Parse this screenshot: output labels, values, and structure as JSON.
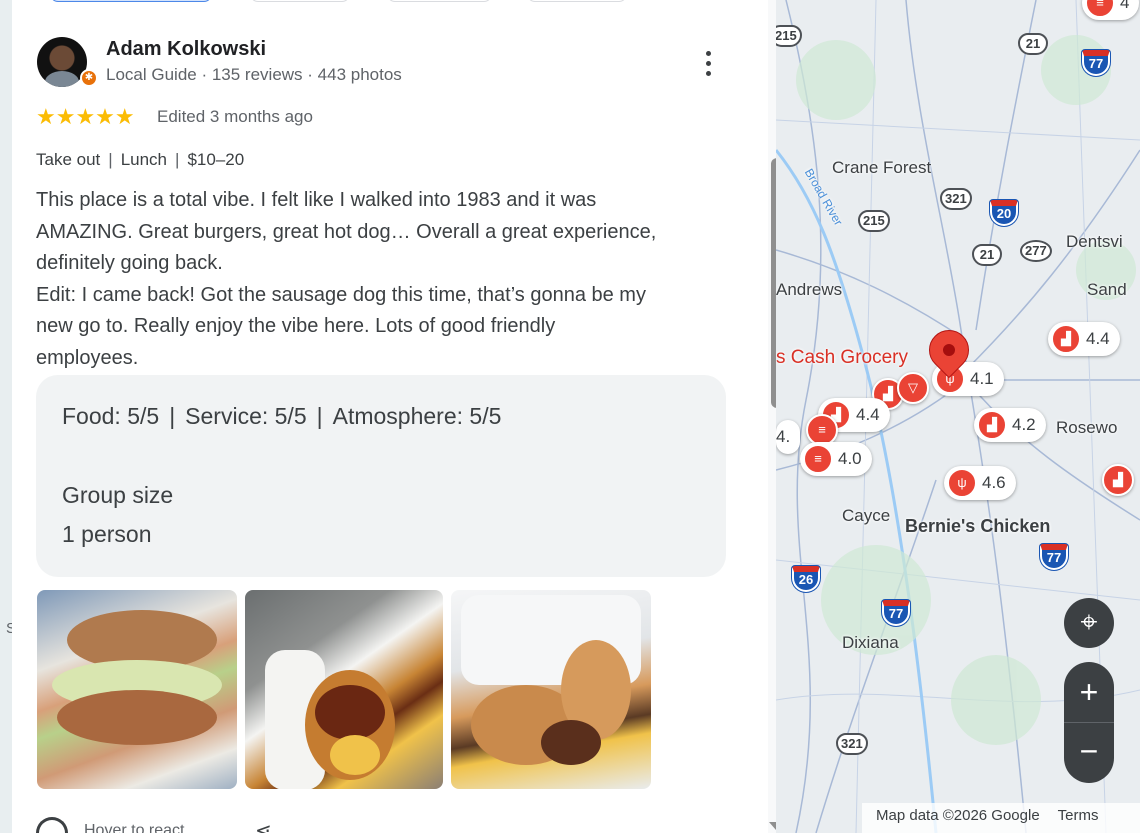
{
  "left_strip": {
    "edge_label": "S"
  },
  "review": {
    "reviewer_name": "Adam Kolkowski",
    "reviewer_meta": "Local Guide · 135 reviews · 443 photos",
    "stars": "★★★★★",
    "rating": 5,
    "edited": "Edited 3 months ago",
    "tags": [
      "Take out",
      "Lunch",
      "$10–20"
    ],
    "tag_separator": "|",
    "text_lines": [
      "This place is a total vibe. I felt like I walked into 1983 and it was",
      "AMAZING. Great burgers, great hot dog… Overall a great experience,",
      "definitely going back.",
      "Edit: I came back! Got the sausage dog this time, that’s gonna be my",
      "new go to. Really enjoy the vibe here. Lots of good friendly",
      "employees."
    ],
    "attributes": {
      "food": "Food: 5/5",
      "service": "Service: 5/5",
      "atmosphere": "Atmosphere: 5/5",
      "separator": "|",
      "group_label": "Group size",
      "group_value": "1 person"
    },
    "react_label": "Hover to react"
  },
  "map": {
    "places": {
      "crane_forest": "Crane Forest",
      "broad_river": "Broad River",
      "andrews": "Andrews",
      "dentsville": "Dentsvi",
      "sandhills": "Sand",
      "cash_grocery": "s Cash Grocery",
      "rosewood": "Rosewo",
      "cayce": "Cayce",
      "bernies": "Bernie's Chicken",
      "dixiana": "Dixiana"
    },
    "shields": {
      "s215a": "215",
      "s21a": "21",
      "s215b": "215",
      "s321a": "321",
      "s21b": "21",
      "s277": "277",
      "s321b": "321"
    },
    "interstates": {
      "i77a": "77",
      "i20": "20",
      "i77b": "77",
      "i26": "26",
      "i77c": "77"
    },
    "ratings": {
      "r44a": "4.4",
      "r41": "4.1",
      "r44b": "4.4",
      "r42": "4.2",
      "r40": "4.0",
      "r46": "4.6",
      "r4a": "4.",
      "r4top": "4"
    },
    "footer": {
      "map_data": "Map data ©2026 Google",
      "terms": "Terms"
    },
    "controls": {
      "locate": "⌖",
      "zoom_in": "+",
      "zoom_out": "−"
    }
  },
  "colors": {
    "star": "#fbbc04",
    "pin": "#ea4335",
    "guide_badge": "#e8710a",
    "interstate": "#1a56b3",
    "control": "#3c4043"
  },
  "icons": {
    "more": "more-vert-icon",
    "heart": "heart-icon",
    "share": "share-icon",
    "locate": "locate-icon"
  }
}
